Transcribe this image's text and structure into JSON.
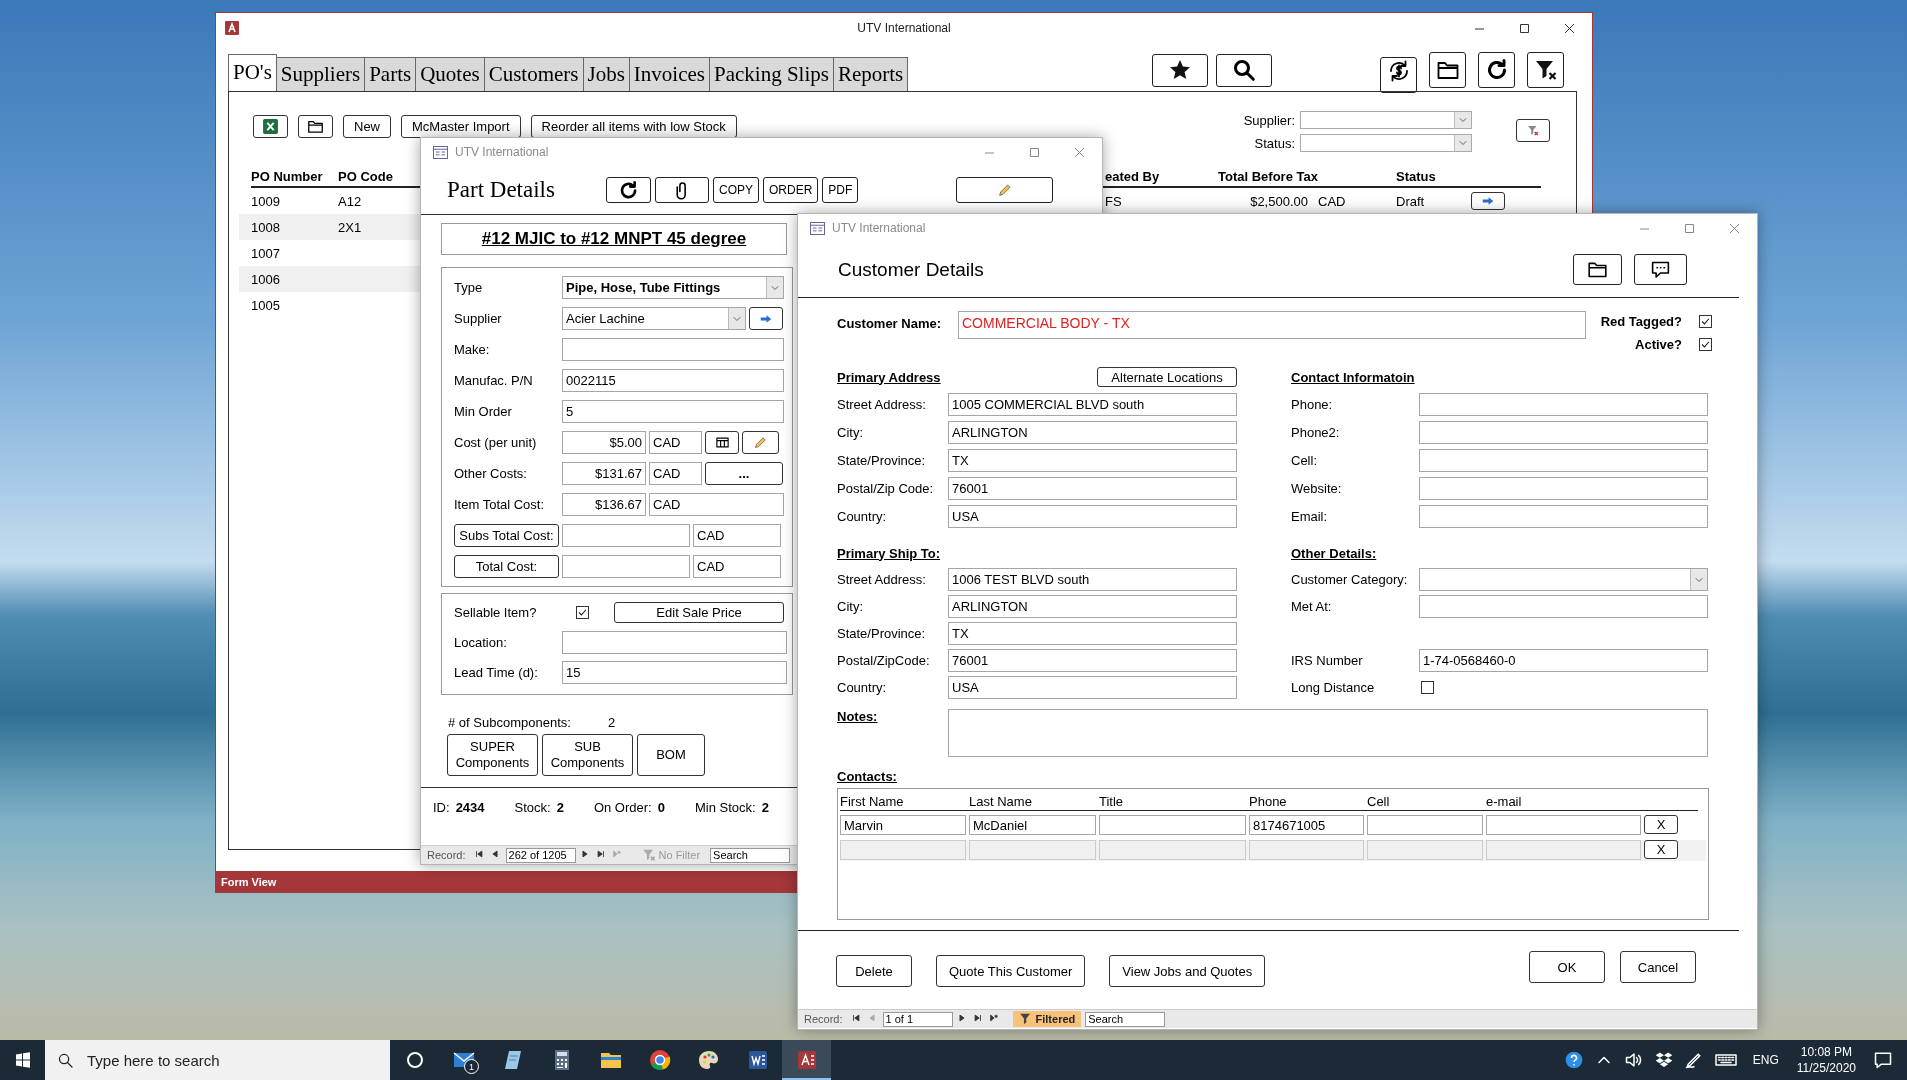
{
  "main_window": {
    "title": "UTV International",
    "tabs": [
      {
        "label": "PO's",
        "selected": true
      },
      {
        "label": "Suppliers",
        "selected": false
      },
      {
        "label": "Parts",
        "selected": false
      },
      {
        "label": "Quotes",
        "selected": false
      },
      {
        "label": "Customers",
        "selected": false
      },
      {
        "label": "Jobs",
        "selected": false
      },
      {
        "label": "Invoices",
        "selected": false
      },
      {
        "label": "Packing Slips",
        "selected": false
      },
      {
        "label": "Reports",
        "selected": false
      }
    ],
    "toolbar_buttons": [
      "New",
      "McMaster Import",
      "Reorder all items with low Stock"
    ],
    "filters": [
      {
        "label": "Supplier:"
      },
      {
        "label": "Status:"
      }
    ],
    "list_columns": [
      "PO Number",
      "PO Code",
      "eated By",
      "Total Before Tax",
      "Status"
    ],
    "list_rows": [
      {
        "cells": [
          "1009",
          "A12",
          "FS",
          "$2,500.00",
          "CAD",
          "Draft"
        ],
        "open_button": true
      },
      {
        "cells": [
          "1008",
          "2X1"
        ]
      },
      {
        "cells": [
          "1007"
        ]
      },
      {
        "cells": [
          "1006"
        ]
      },
      {
        "cells": [
          "1005"
        ]
      }
    ],
    "status_bar": "Form View"
  },
  "part_window": {
    "title": "UTV International",
    "heading": "Part Details",
    "toolbar_buttons": [
      {
        "kind": "refresh"
      },
      {
        "kind": "attach"
      },
      {
        "kind": "text",
        "label": "COPY"
      },
      {
        "kind": "text",
        "label": "ORDER"
      },
      {
        "kind": "text",
        "label": "PDF"
      },
      {
        "kind": "edit"
      }
    ],
    "part_name": "#12 MJIC to #12 MNPT 45 degree",
    "cost_fields": [
      {
        "kind": "combo",
        "label": "Type",
        "value": "Pipe, Hose, Tube Fittings",
        "bold": true
      },
      {
        "kind": "combo_link",
        "label": "Supplier",
        "value": "Acier Lachine"
      },
      {
        "kind": "text",
        "label": "Make:"
      },
      {
        "kind": "text",
        "label": "Manufac. P/N",
        "value": "0022115"
      },
      {
        "kind": "text",
        "label": "Min Order",
        "value": "5"
      },
      {
        "kind": "amount_tools",
        "label": "Cost (per unit)",
        "value": "$5.00",
        "currency": "CAD"
      },
      {
        "kind": "amount_more",
        "label": "Other Costs:",
        "value": "$131.67",
        "currency": "CAD",
        "button": "..."
      },
      {
        "kind": "amount",
        "label": "Item Total Cost:",
        "value": "$136.67",
        "currency": "CAD"
      },
      {
        "kind": "total_button",
        "label": "Subs Total Cost:",
        "currency": "CAD"
      },
      {
        "kind": "total_button",
        "label": "Total Cost:",
        "currency": "CAD"
      }
    ],
    "sellable": {
      "label": "Sellable Item?",
      "checked": true,
      "button": "Edit Sale Price"
    },
    "stock_fields": [
      {
        "label": "Location:"
      },
      {
        "label": "Lead Time (d):",
        "value": "15"
      }
    ],
    "subcomponents": {
      "label": "# of Subcomponents:",
      "count": "2",
      "buttons": [
        "SUPER Components",
        "SUB Components",
        "BOM"
      ]
    },
    "info": [
      {
        "label": "ID:",
        "value": "2434"
      },
      {
        "label": "Stock:",
        "value": "2"
      },
      {
        "label": "On Order:",
        "value": "0"
      },
      {
        "label": "Min Stock:",
        "value": "2"
      }
    ],
    "record_nav": {
      "label": "Record:",
      "position": "262 of 1205",
      "filter": "No Filter",
      "filter_active": false,
      "search": "Search"
    }
  },
  "customer_window": {
    "title": "UTV International",
    "heading": "Customer Details",
    "customer_name": {
      "label": "Customer Name:",
      "value": "COMMERCIAL BODY - TX"
    },
    "flags": [
      {
        "label": "Red Tagged?",
        "checked": true
      },
      {
        "label": "Active?",
        "checked": true
      }
    ],
    "primary_address": {
      "heading": "Primary Address",
      "button": "Alternate Locations",
      "fields": [
        {
          "label": "Street Address:",
          "value": "1005 COMMERCIAL BLVD south"
        },
        {
          "label": "City:",
          "value": "ARLINGTON"
        },
        {
          "label": "State/Province:",
          "value": "TX"
        },
        {
          "label": "Postal/Zip Code:",
          "value": "76001"
        },
        {
          "label": "Country:",
          "value": "USA"
        }
      ]
    },
    "contact_information": {
      "heading": "Contact Informatoin",
      "fields": [
        {
          "kind": "text",
          "label": "Phone:"
        },
        {
          "kind": "text",
          "label": "Phone2:"
        },
        {
          "kind": "text",
          "label": "Cell:"
        },
        {
          "kind": "text",
          "label": "Website:"
        },
        {
          "kind": "text",
          "label": "Email:"
        }
      ]
    },
    "primary_ship_to": {
      "heading": "Primary Ship To:",
      "fields": [
        {
          "label": "Street Address:",
          "value": "1006 TEST BLVD south"
        },
        {
          "label": "City:",
          "value": "ARLINGTON"
        },
        {
          "label": "State/Province:",
          "value": "TX"
        },
        {
          "label": "Postal/ZipCode:",
          "value": "76001"
        },
        {
          "label": "Country:",
          "value": "USA"
        }
      ]
    },
    "other_details": {
      "heading": "Other Details:",
      "fields": [
        {
          "kind": "combo",
          "label": "Customer Category:"
        },
        {
          "kind": "text",
          "label": "Met At:"
        },
        {
          "kind": "text",
          "label": "IRS Number",
          "value": "1-74-0568460-0"
        },
        {
          "kind": "checkbox",
          "label": "Long Distance",
          "checked": false
        }
      ]
    },
    "notes": {
      "label": "Notes:"
    },
    "contacts": {
      "label": "Contacts:",
      "columns": [
        "First Name",
        "Last Name",
        "Title",
        "Phone",
        "Cell",
        "e-mail"
      ],
      "rows": [
        {
          "first_name": "Marvin",
          "last_name": "McDaniel",
          "phone": "8174671005",
          "delete_button": "X",
          "new_record": false
        },
        {
          "delete_button": "X",
          "new_record": true
        }
      ]
    },
    "buttons": [
      "Delete",
      "Quote This Customer",
      "View Jobs and Quotes"
    ],
    "dialog_buttons": [
      "OK",
      "Cancel"
    ],
    "record_nav": {
      "label": "Record:",
      "position": "1 of 1",
      "filter": "Filtered",
      "filter_active": true,
      "search": "Search"
    }
  },
  "taskbar": {
    "search_placeholder": "Type here to search",
    "apps": [
      {
        "kind": "mail",
        "badge": "1",
        "active": false
      },
      {
        "kind": "note",
        "active": false
      },
      {
        "kind": "calculator",
        "active": false
      },
      {
        "kind": "files",
        "active": false
      },
      {
        "kind": "browser",
        "active": false
      },
      {
        "kind": "paint",
        "active": false
      },
      {
        "kind": "word",
        "active": false
      },
      {
        "kind": "access",
        "active": true
      }
    ],
    "language": "ENG",
    "time": "10:08 PM",
    "date": "11/25/2020"
  }
}
